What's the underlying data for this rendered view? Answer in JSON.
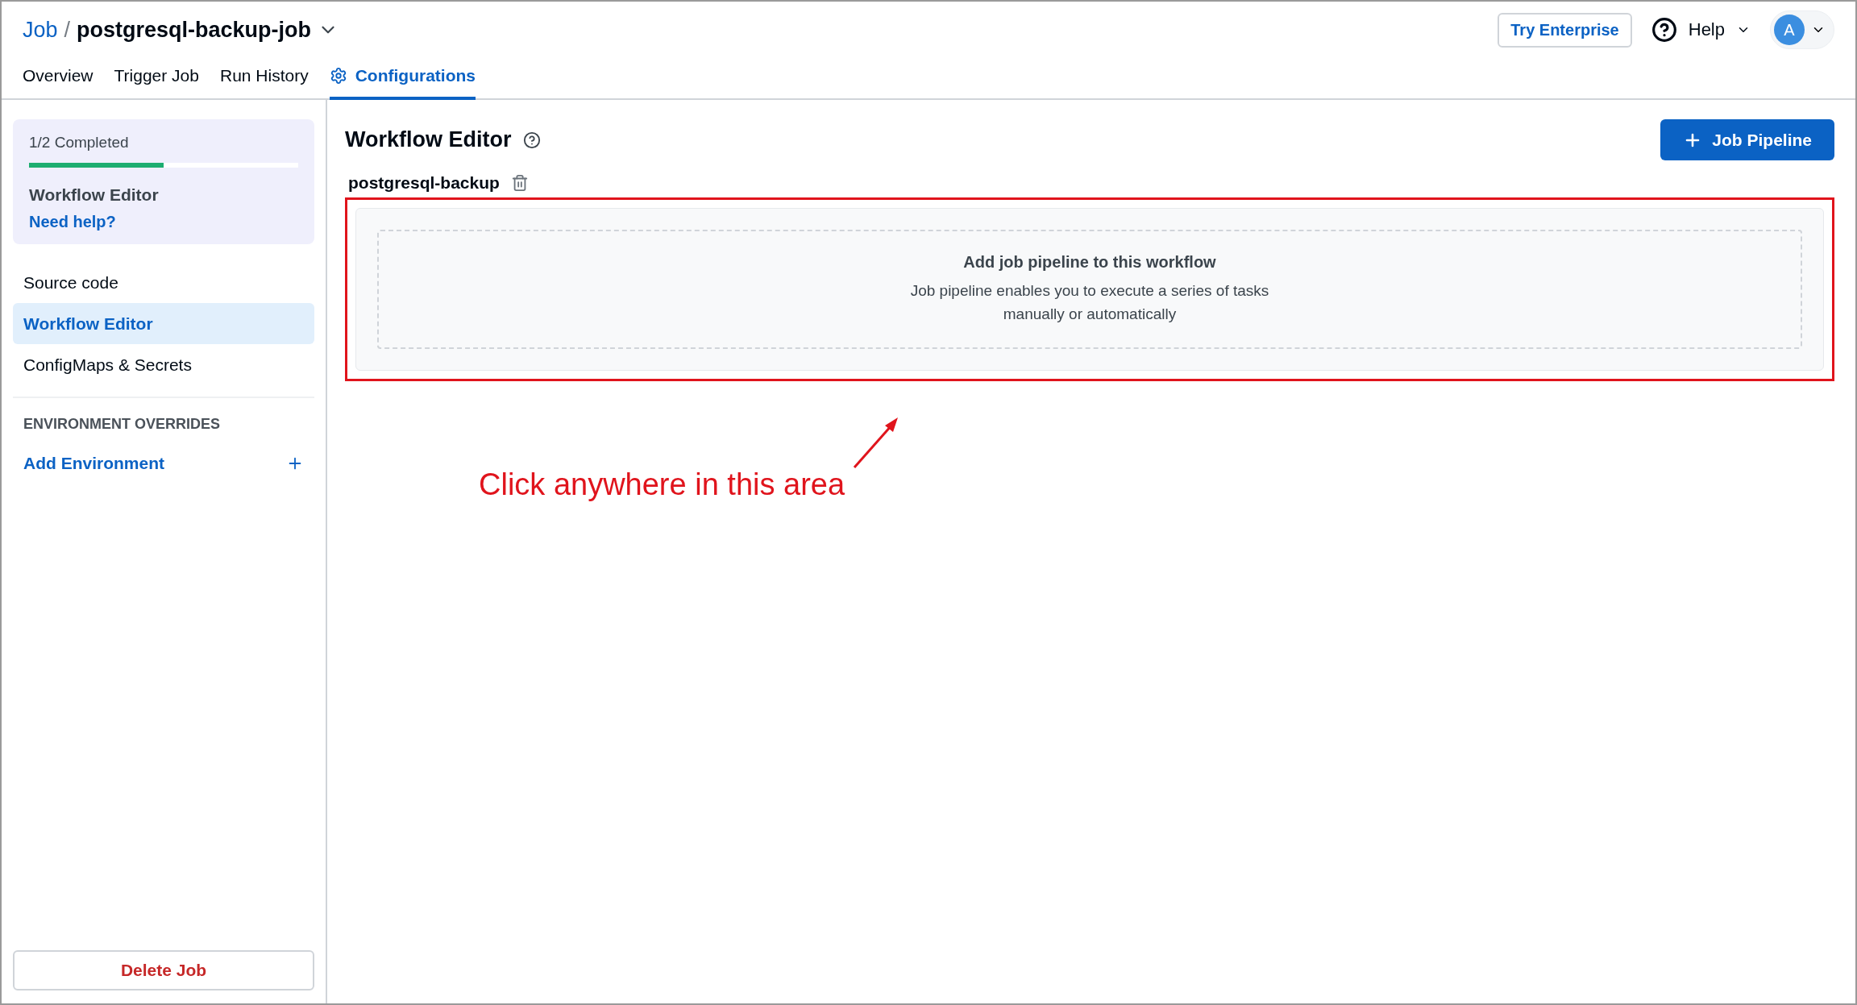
{
  "breadcrumb": {
    "parent": "Job",
    "separator": "/",
    "title": "postgresql-backup-job"
  },
  "header_actions": {
    "try_enterprise": "Try Enterprise",
    "help": "Help",
    "avatar": "A"
  },
  "tabs": [
    {
      "label": "Overview",
      "selected": false,
      "kind": "plain"
    },
    {
      "label": "Trigger Job",
      "selected": false,
      "kind": "plain"
    },
    {
      "label": "Run History",
      "selected": false,
      "kind": "plain"
    },
    {
      "label": "Configurations",
      "selected": true,
      "kind": "gear"
    }
  ],
  "sidebar": {
    "progress": {
      "label": "1/2 Completed",
      "level": 0.5,
      "step": "Workflow Editor",
      "help_link": "Need help?"
    },
    "items": [
      {
        "label": "Source code",
        "selected": false
      },
      {
        "label": "Workflow Editor",
        "selected": true
      },
      {
        "label": "ConfigMaps & Secrets",
        "selected": false
      }
    ],
    "section_title": "ENVIRONMENT OVERRIDES",
    "add_environment": "Add Environment",
    "delete_button": "Delete Job"
  },
  "main": {
    "title": "Workflow Editor",
    "add_button": "Job Pipeline",
    "workflow": {
      "name": "postgresql-backup",
      "empty_title": "Add job pipeline to this workflow",
      "empty_text": "Job pipeline enables you to execute a series of tasks\nmanually or automatically"
    }
  },
  "annotation": {
    "text": "Click anywhere in this area"
  }
}
